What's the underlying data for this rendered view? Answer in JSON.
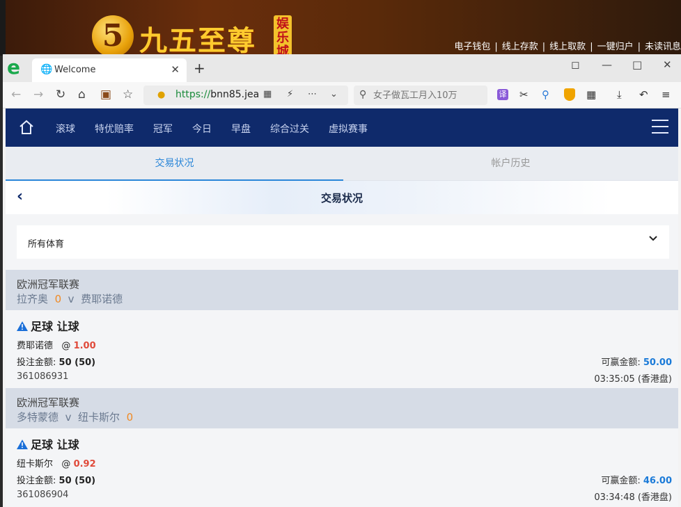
{
  "banner": {
    "logo_digit": "5",
    "logo_text": "九五至尊",
    "logo_badge": "娱乐城",
    "links": [
      "电子钱包",
      "线上存款",
      "线上取款",
      "一键归户",
      "未读讯息"
    ]
  },
  "browser": {
    "tab_title": "Welcome",
    "url_scheme": "https://",
    "url_rest": "bnn85.jea",
    "search_placeholder": "女子做瓦工月入10万",
    "translate_label": "译"
  },
  "site": {
    "nav": [
      "滚球",
      "特优赔率",
      "冠军",
      "今日",
      "早盘",
      "综合过关",
      "虚拟赛事"
    ],
    "tabs": [
      "交易状况",
      "帐户历史"
    ],
    "page_title": "交易状况",
    "sport_filter": "所有体育"
  },
  "bets": [
    {
      "league": "欧洲冠军联赛",
      "home": "拉齐奥",
      "score": "0",
      "vs": "v",
      "away": "费耶诺德",
      "bet_type": "足球 让球",
      "selection": "费耶诺德",
      "at": "@",
      "odds": "1.00",
      "stake_label": "投注金额:",
      "stake": "50 (50)",
      "win_label": "可赢金额:",
      "win": "50.00",
      "ticket_id": "361086931",
      "time": "03:35:05 (香港盘)"
    },
    {
      "league": "欧洲冠军联赛",
      "home": "多特蒙德",
      "vs": "v",
      "away": "纽卡斯尔",
      "score": "0",
      "bet_type": "足球 让球",
      "selection": "纽卡斯尔",
      "at": "@",
      "odds": "0.92",
      "stake_label": "投注金额:",
      "stake": "50 (50)",
      "win_label": "可赢金额:",
      "win": "46.00",
      "ticket_id": "361086904",
      "time": "03:34:48 (香港盘)"
    }
  ]
}
